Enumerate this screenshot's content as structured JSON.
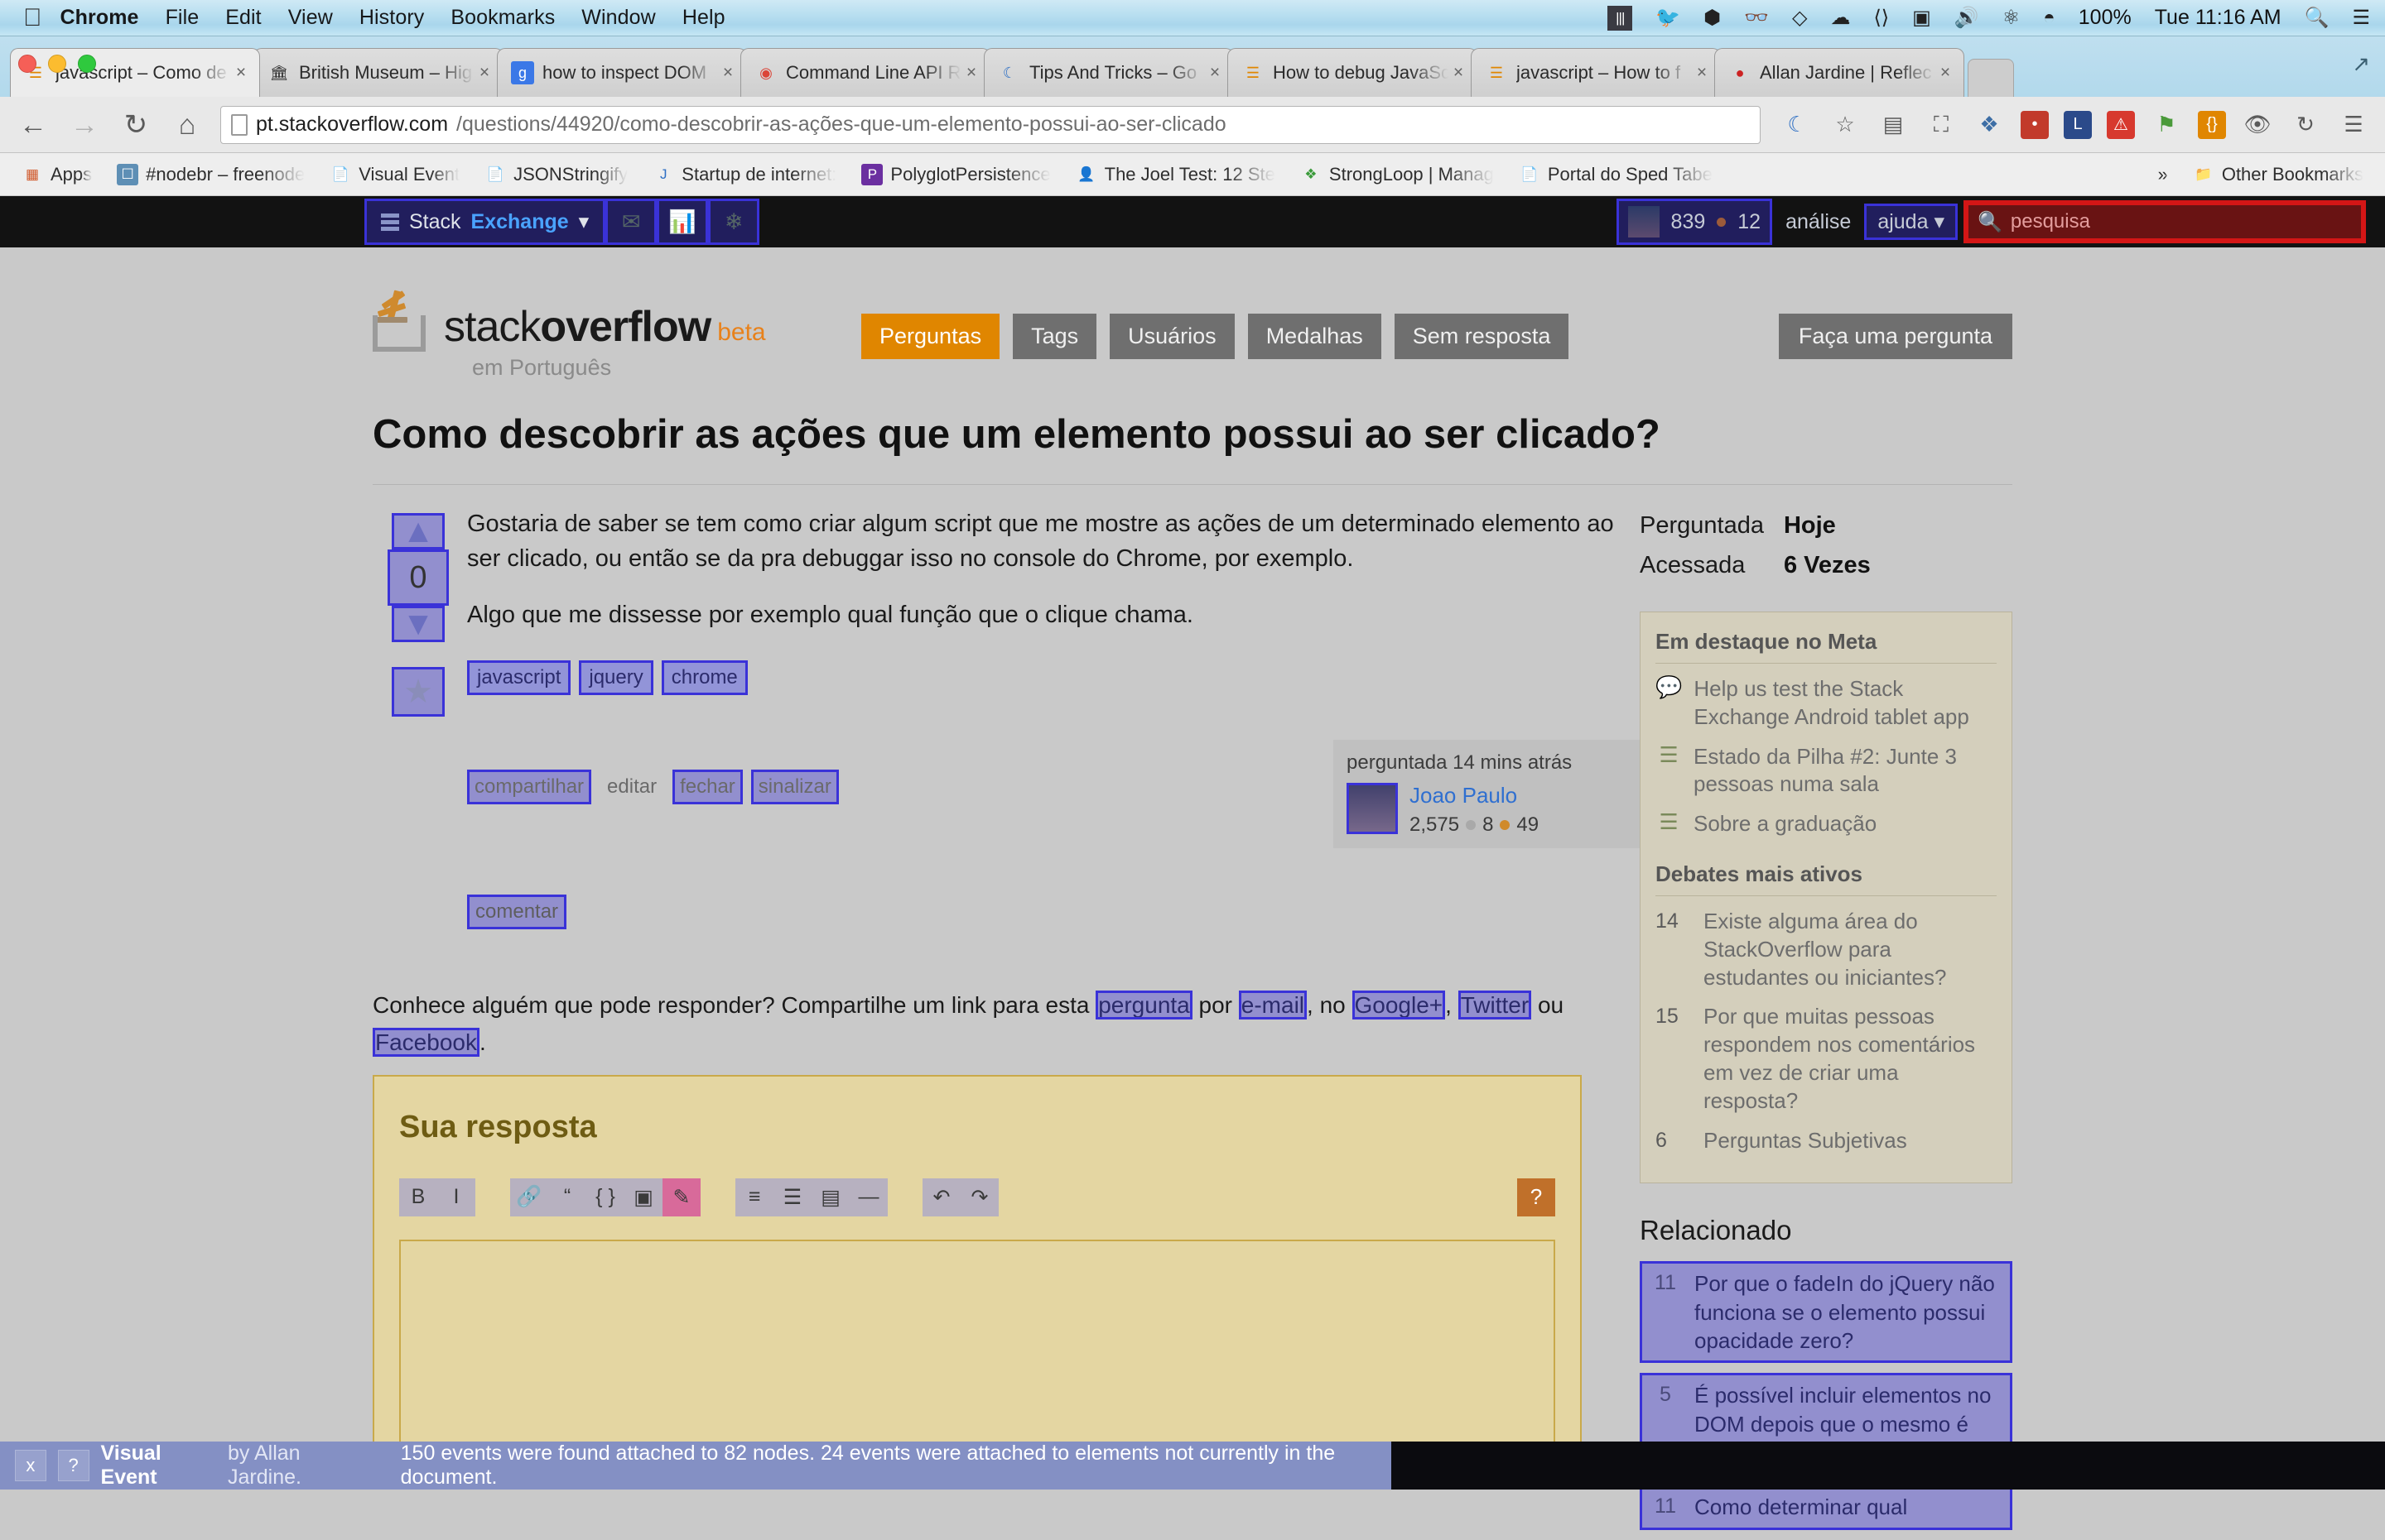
{
  "mac_menu": {
    "apple_icon": "apple-icon",
    "items": [
      "Chrome",
      "File",
      "Edit",
      "View",
      "History",
      "Bookmarks",
      "Window",
      "Help"
    ],
    "tray_icons": [
      "equalizer-icon",
      "twitter-icon",
      "stack-icon",
      "glasses-icon",
      "dropbox-icon",
      "battery-icon",
      "volume-icon",
      "bluetooth-icon",
      "wifi-icon"
    ],
    "battery": "100%",
    "clock": "Tue 11:16 AM",
    "search_icon": "spotlight-search-icon",
    "menu_icon": "notification-center-icon"
  },
  "browser": {
    "tabs": [
      {
        "title": "javascript – Como de",
        "favicon": "stackoverflow-icon",
        "active": true
      },
      {
        "title": "British Museum – Hig",
        "favicon": "museum-icon",
        "active": false
      },
      {
        "title": "how to inspect DOM",
        "favicon": "google-icon",
        "active": false
      },
      {
        "title": "Command Line API R",
        "favicon": "chrome-icon",
        "active": false
      },
      {
        "title": "Tips And Tricks – Go",
        "favicon": "moon-icon",
        "active": false
      },
      {
        "title": "How to debug JavaSc",
        "favicon": "stackoverflow-icon",
        "active": false
      },
      {
        "title": "javascript – How to f",
        "favicon": "stackoverflow-icon",
        "active": false
      },
      {
        "title": "Allan Jardine | Reflec",
        "favicon": "allan-icon",
        "active": false
      }
    ],
    "tab_close_label": "×",
    "new_tab_label": "",
    "nav": {
      "back": "←",
      "forward": "→",
      "reload": "↻",
      "home": "⌂"
    },
    "url_host": "pt.stackoverflow.com",
    "url_path": "/questions/44920/como-descobrir-as-ações-que-um-elemento-possui-ao-ser-clicado",
    "toolbar_icons": [
      "moon-icon",
      "star-icon",
      "translate-icon",
      "image-icon",
      "bookmark-icon",
      "lastpass-icon",
      "L-icon",
      "shield-icon",
      "puzzle-icon",
      "json-icon",
      "eye-icon",
      "refresh-icon",
      "menu-icon"
    ],
    "bookmarks": [
      {
        "label": "Apps",
        "icon": "apps-grid-icon"
      },
      {
        "label": "#nodebr – freenode",
        "icon": "irc-icon"
      },
      {
        "label": "Visual Event",
        "icon": "page-icon"
      },
      {
        "label": "JSONStringify",
        "icon": "page-icon"
      },
      {
        "label": "Startup de internet:",
        "icon": "j-icon"
      },
      {
        "label": "PolyglotPersistence",
        "icon": "p-icon"
      },
      {
        "label": "The Joel Test: 12 Ste",
        "icon": "joel-icon"
      },
      {
        "label": "StrongLoop | Manag",
        "icon": "strongloop-icon"
      },
      {
        "label": "Portal do Sped Tabe",
        "icon": "page-icon"
      }
    ],
    "overflow_label": "»",
    "other_bookmarks": {
      "label": "Other Bookmarks",
      "icon": "folder-icon"
    }
  },
  "se_bar": {
    "brand_prefix": "Stack",
    "brand_suffix": "Exchange",
    "brand_caret": "▾",
    "icons": [
      "inbox-icon",
      "achievements-icon",
      "winter-bash-icon"
    ],
    "avatar": "user-avatar",
    "reputation": "839",
    "badge_count": "12",
    "links": [
      "análise"
    ],
    "help_label": "ajuda",
    "help_caret": "▾",
    "search_placeholder": "pesquisa",
    "search_icon": "search-icon"
  },
  "so": {
    "logo_text_light": "stack",
    "logo_text_bold": "overflow",
    "beta": "beta",
    "subtitle": "em Português",
    "nav": [
      {
        "label": "Perguntas",
        "active": true
      },
      {
        "label": "Tags",
        "active": false
      },
      {
        "label": "Usuários",
        "active": false
      },
      {
        "label": "Medalhas",
        "active": false
      },
      {
        "label": "Sem resposta",
        "active": false
      }
    ],
    "ask_button": "Faça uma pergunta"
  },
  "question": {
    "title": "Como descobrir as ações que um elemento possui ao ser clicado?",
    "vote_up_icon": "vote-up-arrow-icon",
    "vote_down_icon": "vote-down-arrow-icon",
    "vote_count": "0",
    "favorite_icon": "star-icon",
    "paragraphs": [
      "Gostaria de saber se tem como criar algum script que me mostre as ações de um determinado elemento ao ser clicado, ou então se da pra debuggar isso no console do Chrome, por exemplo.",
      "Algo que me dissesse por exemplo qual função que o clique chama."
    ],
    "tags": [
      "javascript",
      "jquery",
      "chrome"
    ],
    "actions": [
      "compartilhar",
      "editar",
      "fechar",
      "sinalizar"
    ],
    "comment_label": "comentar",
    "asked_label": "perguntada 14 mins atrás",
    "author": {
      "name": "Joao Paulo",
      "reputation": "2,575",
      "silver": "8",
      "bronze": "49",
      "avatar": "author-avatar"
    }
  },
  "sidebar": {
    "stats": [
      {
        "key": "Perguntada",
        "value": "Hoje"
      },
      {
        "key": "Acessada",
        "value": "6 Vezes"
      }
    ],
    "meta_header": "Em destaque no Meta",
    "meta_items": [
      {
        "icon": "speech-bubble-icon",
        "text": "Help us test the Stack Exchange Android tablet app"
      },
      {
        "icon": "stackexchange-icon",
        "text": "Estado da Pilha #2: Junte 3 pessoas numa sala"
      },
      {
        "icon": "stackexchange-icon",
        "text": "Sobre a graduação"
      }
    ],
    "hot_header": "Debates mais ativos",
    "hot_items": [
      {
        "num": "14",
        "text": "Existe alguma área do StackOverflow para estudantes ou iniciantes?"
      },
      {
        "num": "15",
        "text": "Por que muitas pessoas respondem nos comentários em vez de criar uma resposta?"
      },
      {
        "num": "6",
        "text": "Perguntas Subjetivas"
      }
    ],
    "related_header": "Relacionado",
    "related_items": [
      {
        "num": "11",
        "text": "Por que o fadeIn do jQuery não funciona se o elemento possui opacidade zero?"
      },
      {
        "num": "5",
        "text": "É possível incluir elementos no DOM depois que o mesmo é carregado e pronto?"
      },
      {
        "num": "11",
        "text": "Como determinar qual"
      }
    ]
  },
  "share": {
    "lead": "Conhece alguém que pode responder? Compartilhe um link para esta ",
    "link_question": "pergunta",
    "mid1": " por ",
    "link_email": "e-mail",
    "mid2": ", no ",
    "link_google": "Google+",
    "mid3": ", ",
    "link_twitter": "Twitter",
    "mid4": " ou ",
    "link_facebook": "Facebook",
    "tail": "."
  },
  "answer": {
    "heading": "Sua resposta",
    "toolbar": [
      {
        "icon": "bold-icon",
        "glyph": "B"
      },
      {
        "icon": "italic-icon",
        "glyph": "I"
      },
      {
        "icon": "link-icon",
        "glyph": "🔗"
      },
      {
        "icon": "blockquote-icon",
        "glyph": "“"
      },
      {
        "icon": "code-icon",
        "glyph": "{ }"
      },
      {
        "icon": "image-icon",
        "glyph": "▣"
      },
      {
        "icon": "edit-icon",
        "glyph": "✎"
      },
      {
        "icon": "numbered-list-icon",
        "glyph": "≡"
      },
      {
        "icon": "bulleted-list-icon",
        "glyph": "☰"
      },
      {
        "icon": "heading-icon",
        "glyph": "▤"
      },
      {
        "icon": "hr-icon",
        "glyph": "—"
      },
      {
        "icon": "undo-icon",
        "glyph": "↶"
      },
      {
        "icon": "redo-icon",
        "glyph": "↷"
      }
    ],
    "help_label": "?",
    "textarea_value": "",
    "textarea_placeholder": ""
  },
  "visual_event": {
    "close_label": "x",
    "help_label": "?",
    "title": "Visual Event",
    "by": " by Allan Jardine.",
    "message": "150 events were found attached to 82 nodes. 24 events were attached to elements not currently in the document."
  },
  "colors": {
    "accent_orange": "#e08600",
    "se_blue": "#4aa3ff",
    "ve_highlight": "#3a32d8",
    "ve_red": "#d41616",
    "editor_bg": "#e4d6a2"
  }
}
